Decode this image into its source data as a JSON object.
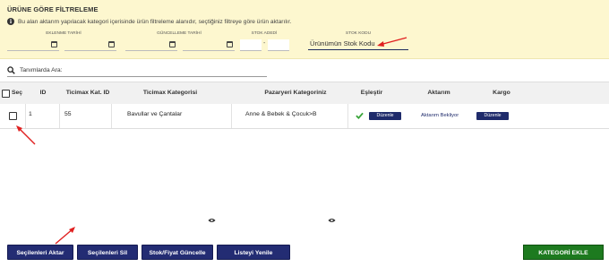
{
  "filter_panel": {
    "title": "ÜRÜNE GÖRE FİLTRELEME",
    "info": "Bu alan aktarım yapılacak kategori içerisinde ürün filtreleme alanıdır, seçtiğiniz filtreye göre ürün aktarılır.",
    "labels": {
      "created_date": "EKLENME TARİHİ",
      "updated_date": "GÜNCELLEME TARİHİ",
      "stock_count": "STOK ADEDİ",
      "stock_code": "STOK KODU"
    },
    "stock_range_separator": "-",
    "stock_code_value": "Ürünümün Stok Kodu"
  },
  "search": {
    "label": "Tanımlarda Ara:"
  },
  "table": {
    "headers": {
      "select": "Seç",
      "id": "ID",
      "ticimax_cat_id": "Ticimax Kat. ID",
      "ticimax_category": "Ticimax Kategorisi",
      "marketplace_category": "Pazaryeri Kategoriniz",
      "match": "Eşleştir",
      "transfer": "Aktarım",
      "cargo": "Kargo"
    },
    "rows": [
      {
        "id": "1",
        "ticimax_cat_id": "55",
        "ticimax_category": "Bavullar ve Çantalar",
        "marketplace_category": "Anne & Bebek & Çocuk>B",
        "match_button": "Düzenle",
        "transfer_status": "Aktarım Bekliyor",
        "cargo_button": "Düzenle"
      }
    ]
  },
  "actions": {
    "transfer_selected": "Seçilenleri Aktar",
    "delete_selected": "Seçilenleri Sil",
    "stock_price_update": "Stok/Fiyat Güncelle",
    "refresh_list": "Listeyi Yenile",
    "add_category": "KATEGORİ EKLE"
  },
  "colors": {
    "panel_bg": "#fdf7cf",
    "button_navy": "#232c73",
    "button_green": "#1d7a1f",
    "annotation_red": "#e02020"
  }
}
